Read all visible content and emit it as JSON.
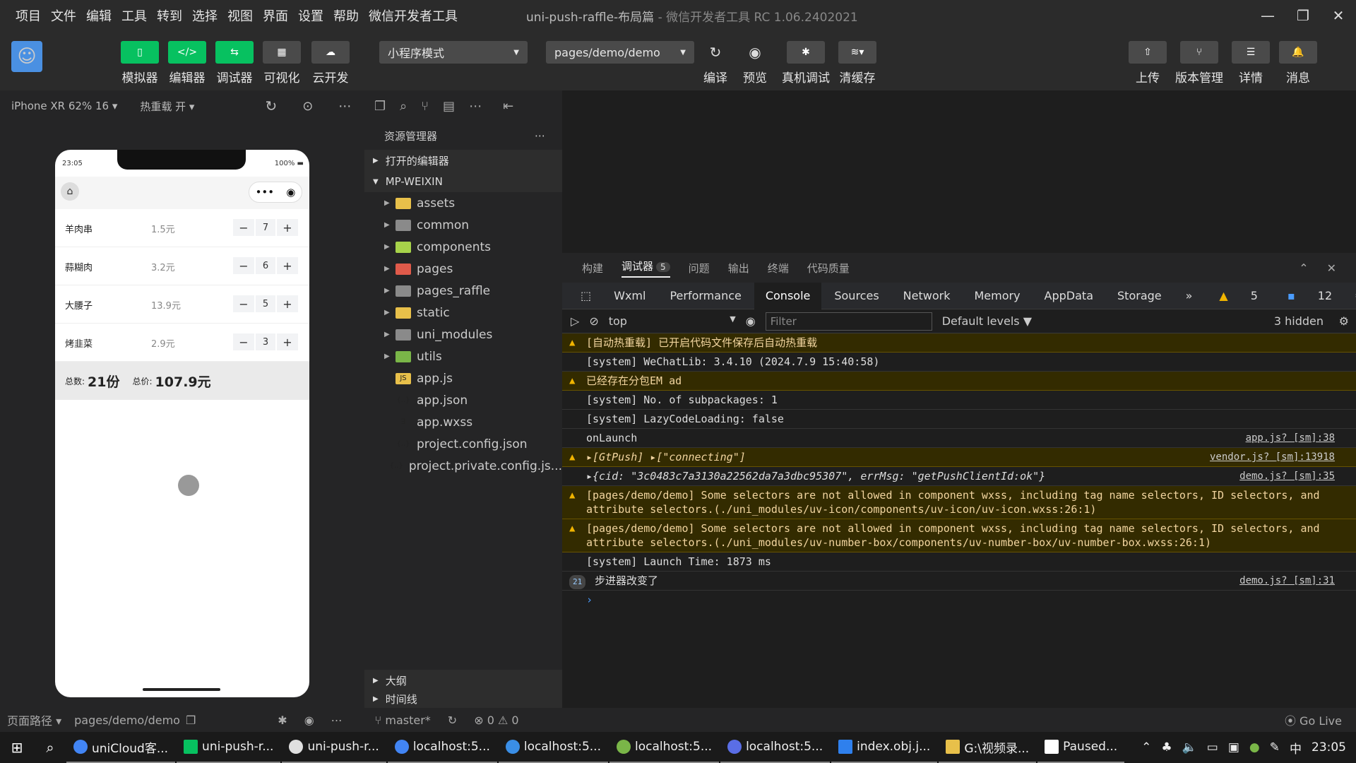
{
  "menu": [
    "项目",
    "文件",
    "编辑",
    "工具",
    "转到",
    "选择",
    "视图",
    "界面",
    "设置",
    "帮助",
    "微信开发者工具"
  ],
  "window": {
    "title": "uni-push-raffle-布局篇",
    "subtitle": "- 微信开发者工具 RC 1.06.2402021"
  },
  "toolbar": {
    "left_buttons": [
      {
        "label": "模拟器",
        "icon": "phone-icon"
      },
      {
        "label": "编辑器",
        "icon": "code-icon"
      },
      {
        "label": "调试器",
        "icon": "debug-icon"
      },
      {
        "label": "可视化",
        "icon": "layout-icon"
      },
      {
        "label": "云开发",
        "icon": "cloud-icon"
      }
    ],
    "mode_select": "小程序模式",
    "page_select": "pages/demo/demo",
    "mid_buttons": [
      {
        "label": "编译",
        "icon": "refresh-icon"
      },
      {
        "label": "预览",
        "icon": "eye-icon"
      },
      {
        "label": "真机调试",
        "icon": "bug-icon"
      },
      {
        "label": "清缓存",
        "icon": "layers-icon"
      }
    ],
    "right_buttons": [
      {
        "label": "上传",
        "icon": "upload-icon"
      },
      {
        "label": "版本管理",
        "icon": "branch-icon"
      },
      {
        "label": "详情",
        "icon": "menu-icon"
      },
      {
        "label": "消息",
        "icon": "bell-icon"
      }
    ]
  },
  "sim": {
    "device": "iPhone XR 62% 16 ▾",
    "hotreload": "热重载 开 ▾",
    "time": "23:05",
    "battery": "100%",
    "items": [
      {
        "name": "羊肉串",
        "price": "1.5元",
        "qty": "7"
      },
      {
        "name": "蒜糊肉",
        "price": "3.2元",
        "qty": "6"
      },
      {
        "name": "大腰子",
        "price": "13.9元",
        "qty": "5"
      },
      {
        "name": "烤韭菜",
        "price": "2.9元",
        "qty": "3"
      }
    ],
    "total_count_label": "总数:",
    "total_count": "21份",
    "total_price_label": "总价:",
    "total_price": "107.9元"
  },
  "explorer": {
    "title": "资源管理器",
    "open_editors": "打开的编辑器",
    "project": "MP-WEIXIN",
    "folders": [
      {
        "name": "assets",
        "cls": "fold-y"
      },
      {
        "name": "common",
        "cls": "fold-g"
      },
      {
        "name": "components",
        "cls": "fold-c"
      },
      {
        "name": "pages",
        "cls": "fold-r"
      },
      {
        "name": "pages_raffle",
        "cls": "fold-g"
      },
      {
        "name": "static",
        "cls": "fold-y"
      },
      {
        "name": "uni_modules",
        "cls": "fold-g"
      },
      {
        "name": "utils",
        "cls": "fold-lg"
      }
    ],
    "files": [
      {
        "name": "app.js",
        "glyph": "JS",
        "cls": "js"
      },
      {
        "name": "app.json",
        "glyph": "{..}",
        "cls": "json"
      },
      {
        "name": "app.wxss",
        "glyph": "∃",
        "cls": "wxss"
      },
      {
        "name": "project.config.json",
        "glyph": "{..}",
        "cls": "json"
      },
      {
        "name": "project.private.config.js...",
        "glyph": "{..}",
        "cls": "json"
      }
    ],
    "outline": "大纲",
    "timeline": "时间线"
  },
  "devtools": {
    "tabs": [
      "构建",
      "调试器",
      "问题",
      "输出",
      "终端",
      "代码质量"
    ],
    "debugger_badge": "5",
    "panels": [
      "Wxml",
      "Performance",
      "Console",
      "Sources",
      "Network",
      "Memory",
      "AppData",
      "Storage"
    ],
    "warn_count": "5",
    "info_count": "12",
    "context": "top",
    "filter_placeholder": "Filter",
    "levels": "Default levels ▼",
    "hidden": "3 hidden",
    "logs": [
      {
        "type": "warn",
        "text": "[自动热重载] 已开启代码文件保存后自动热重载",
        "src": ""
      },
      {
        "type": "log",
        "text": "[system] WeChatLib: 3.4.10 (2024.7.9 15:40:58)",
        "src": ""
      },
      {
        "type": "warn",
        "text": "已经存在分包EM ad",
        "src": ""
      },
      {
        "type": "log",
        "text": "[system] No. of subpackages: 1",
        "src": ""
      },
      {
        "type": "log",
        "text": "[system] LazyCodeLoading: false",
        "src": ""
      },
      {
        "type": "log",
        "text": "onLaunch",
        "src": "app.js? [sm]:38"
      },
      {
        "type": "warn",
        "text": "▸[GtPush] ▸[\"connecting\"]",
        "src": "vendor.js? [sm]:13918"
      },
      {
        "type": "log",
        "text": "▸{cid: \"3c0483c7a3130a22562da7a3dbc95307\", errMsg: \"getPushClientId:ok\"}",
        "src": "demo.js? [sm]:35"
      },
      {
        "type": "warn",
        "text": "[pages/demo/demo] Some selectors are not allowed in component wxss, including tag name selectors, ID selectors, and attribute selectors.(./uni_modules/uv-icon/components/uv-icon/uv-icon.wxss:26:1)",
        "src": ""
      },
      {
        "type": "warn",
        "text": "[pages/demo/demo] Some selectors are not allowed in component wxss, including tag name selectors, ID selectors, and attribute selectors.(./uni_modules/uv-number-box/components/uv-number-box/uv-number-box.wxss:26:1)",
        "src": ""
      },
      {
        "type": "log",
        "text": "[system] Launch Time: 1873 ms",
        "src": ""
      },
      {
        "type": "count",
        "count": "21",
        "text": "步进器改变了",
        "src": "demo.js? [sm]:31"
      }
    ]
  },
  "status": {
    "path_label": "页面路径 ▾",
    "path": "pages/demo/demo",
    "branch": "master*",
    "errors": "0",
    "warnings": "0",
    "golive": "Go Live"
  },
  "taskbar": {
    "apps": [
      {
        "label": "uniCloud客...",
        "color": "#4285f4"
      },
      {
        "label": "uni-push-r...",
        "color": "#07c160"
      },
      {
        "label": "uni-push-r...",
        "color": "#e0e0e0"
      },
      {
        "label": "localhost:5...",
        "color": "#4285f4"
      },
      {
        "label": "localhost:5...",
        "color": "#3a8ee6"
      },
      {
        "label": "localhost:5...",
        "color": "#7ab648"
      },
      {
        "label": "localhost:5...",
        "color": "#5a6ee6"
      },
      {
        "label": "index.obj.j...",
        "color": "#2f80ed"
      },
      {
        "label": "G:\\视频录...",
        "color": "#e8c04a"
      },
      {
        "label": "Paused...",
        "color": "#ffffff"
      }
    ],
    "ime": "中",
    "clock": "23:05"
  }
}
